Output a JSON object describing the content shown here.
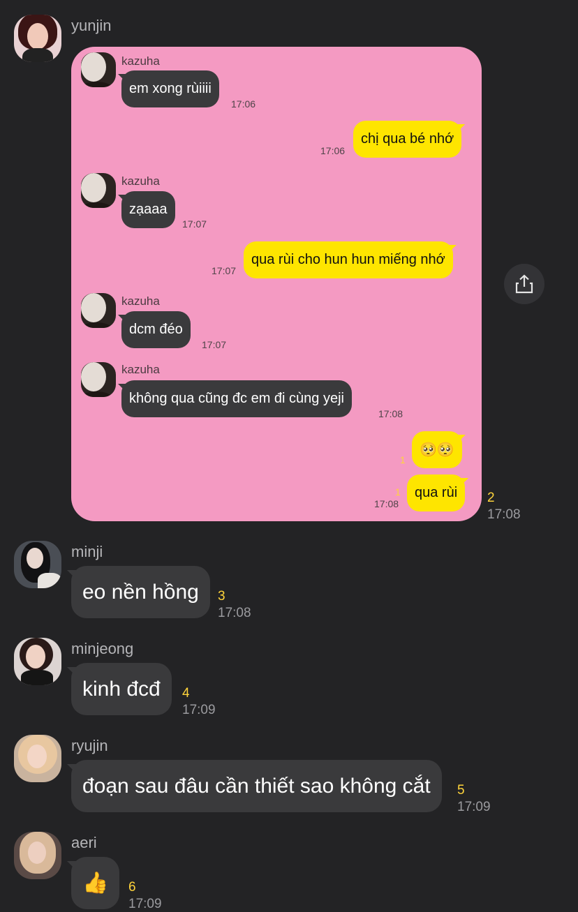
{
  "messages": [
    {
      "sender": "yunjin",
      "type": "image",
      "count": "2",
      "time": "17:08",
      "image_chat": [
        {
          "from": "kazuha",
          "text": "em xong rùiiii",
          "time": "17:06"
        },
        {
          "from": "me",
          "text": "chị qua bé nhớ",
          "time": "17:06"
        },
        {
          "from": "kazuha",
          "text": "zạaaa",
          "time": "17:07"
        },
        {
          "from": "me",
          "text": "qua rùi cho hun hun miếng nhớ",
          "time": "17:07"
        },
        {
          "from": "kazuha",
          "text": "dcm đéo",
          "time": "17:07"
        },
        {
          "from": "kazuha",
          "text": "không qua cũng đc em đi cùng yeji",
          "time": "17:08"
        },
        {
          "from": "me",
          "text": "🥺🥺",
          "count": "1"
        },
        {
          "from": "me",
          "text": "qua rùi",
          "count": "1",
          "time": "17:08"
        }
      ]
    },
    {
      "sender": "minji",
      "text": "eo nền hồng",
      "count": "3",
      "time": "17:08"
    },
    {
      "sender": "minjeong",
      "text": "kinh đcđ",
      "count": "4",
      "time": "17:09"
    },
    {
      "sender": "ryujin",
      "text": "đoạn sau đâu cần thiết sao không cắt",
      "count": "5",
      "time": "17:09"
    },
    {
      "sender": "aeri",
      "text": "👍",
      "count": "6",
      "time": "17:09"
    }
  ],
  "icons": {
    "share": "share-icon"
  },
  "colors": {
    "background": "#232325",
    "bubble": "#3a3a3c",
    "card": "#f49ac2",
    "my_bubble": "#fee500",
    "count": "#ffd43b"
  }
}
